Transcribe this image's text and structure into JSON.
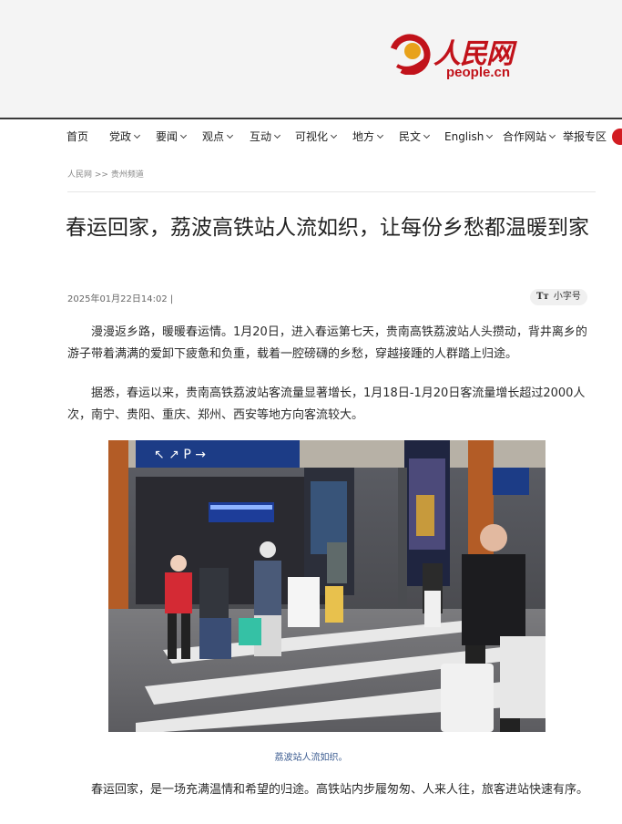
{
  "site": {
    "logo_cn": "人民网",
    "logo_en": "people.cn",
    "brand_color": "#c1121a"
  },
  "nav": {
    "items": [
      {
        "label": "首页",
        "dropdown": false
      },
      {
        "label": "党政",
        "dropdown": true
      },
      {
        "label": "要闻",
        "dropdown": true
      },
      {
        "label": "观点",
        "dropdown": true
      },
      {
        "label": "互动",
        "dropdown": true
      },
      {
        "label": "可视化",
        "dropdown": true
      },
      {
        "label": "地方",
        "dropdown": true
      },
      {
        "label": "民文",
        "dropdown": true
      },
      {
        "label": "English",
        "dropdown": true
      },
      {
        "label": "合作网站",
        "dropdown": true
      },
      {
        "label": "举报专区",
        "dropdown": false
      }
    ]
  },
  "breadcrumb": {
    "home": "人民网",
    "separator": ">>",
    "section": "贵州频道"
  },
  "article": {
    "title": "春运回家，荔波高铁站人流如织，让每份乡愁都温暖到家",
    "date": "2025年01月22日14:02",
    "date_separator": "|",
    "font_toggle_icon": "Tт",
    "font_toggle_label": "小字号",
    "paragraphs": [
      "漫漫返乡路，暖暖春运情。1月20日，进入春运第七天，贵南高铁荔波站人头攒动，背井离乡的游子带着满满的爱卸下疲惫和负重，载着一腔磅礴的乡愁，穿越接踵的人群踏上归途。",
      "据悉，春运以来，贵南高铁荔波站客流量显著增长，1月18日-1月20日客流量增长超过2000人次，南宁、贵阳、重庆、郑州、西安等地方向客流较大。",
      "春运回家，是一场充满温情和希望的归途。高铁站内步履匆匆、人来人往，旅客进站快速有序。"
    ],
    "photo_caption": "荔波站人流如织。"
  }
}
